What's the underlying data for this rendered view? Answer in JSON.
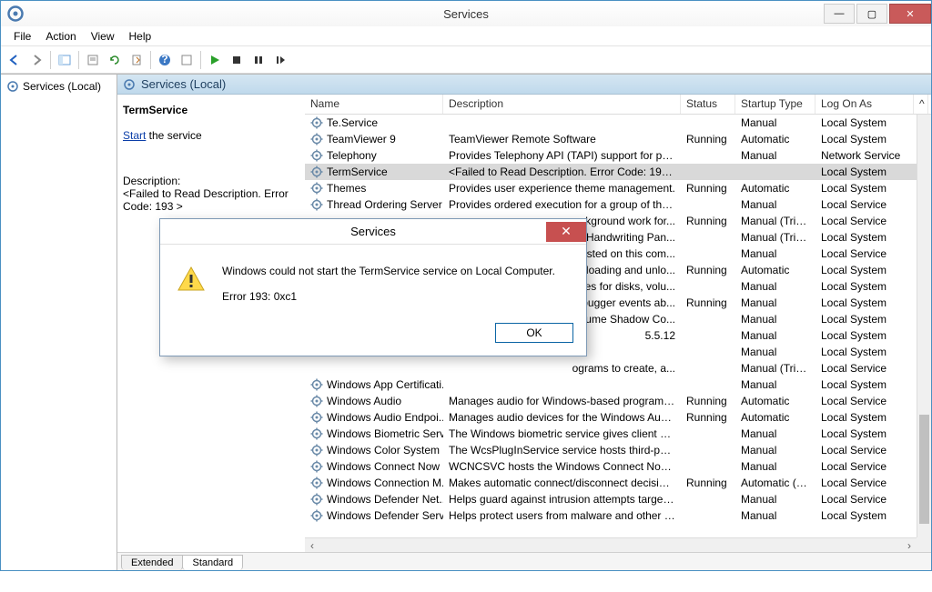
{
  "window": {
    "title": "Services"
  },
  "menubar": [
    "File",
    "Action",
    "View",
    "Help"
  ],
  "tree": {
    "root": "Services (Local)"
  },
  "panel_header": "Services (Local)",
  "detail": {
    "name": "TermService",
    "action_label": "Start",
    "action_suffix": " the service",
    "desc_label": "Description:",
    "desc_value": "<Failed to Read Description. Error Code: 193 >"
  },
  "columns": {
    "name": "Name",
    "description": "Description",
    "status": "Status",
    "startup": "Startup Type",
    "logon": "Log On As"
  },
  "services": [
    {
      "name": "Te.Service",
      "desc": "",
      "status": "",
      "startup": "Manual",
      "logon": "Local System"
    },
    {
      "name": "TeamViewer 9",
      "desc": "TeamViewer Remote Software",
      "status": "Running",
      "startup": "Automatic",
      "logon": "Local System"
    },
    {
      "name": "Telephony",
      "desc": "Provides Telephony API (TAPI) support for pro...",
      "status": "",
      "startup": "Manual",
      "logon": "Network Service"
    },
    {
      "name": "TermService",
      "desc": "<Failed to Read Description. Error Code: 193 >",
      "status": "",
      "startup": "",
      "logon": "Local System",
      "selected": true
    },
    {
      "name": "Themes",
      "desc": "Provides user experience theme management.",
      "status": "Running",
      "startup": "Automatic",
      "logon": "Local System"
    },
    {
      "name": "Thread Ordering Server",
      "desc": "Provides ordered execution for a group of thre...",
      "status": "",
      "startup": "Manual",
      "logon": "Local Service"
    },
    {
      "name": "",
      "desc": "ckground work for...",
      "status": "Running",
      "startup": "Manual (Trig...",
      "logon": "Local Service",
      "obscured": true
    },
    {
      "name": "",
      "desc": "d Handwriting Pan...",
      "status": "",
      "startup": "Manual (Trig...",
      "logon": "Local System",
      "obscured": true
    },
    {
      "name": "",
      "desc": "hosted on this com...",
      "status": "",
      "startup": "Manual",
      "logon": "Local Service",
      "obscured": true
    },
    {
      "name": "",
      "desc": "or loading and unlo...",
      "status": "Running",
      "startup": "Automatic",
      "logon": "Local System",
      "obscured": true
    },
    {
      "name": "",
      "desc": "ces for disks, volu...",
      "status": "",
      "startup": "Manual",
      "logon": "Local System",
      "obscured": true
    },
    {
      "name": "",
      "desc": "ebugger events ab...",
      "status": "Running",
      "startup": "Manual",
      "logon": "Local System",
      "obscured": true
    },
    {
      "name": "",
      "desc": "olume Shadow Co...",
      "status": "",
      "startup": "Manual",
      "logon": "Local System",
      "obscured": true
    },
    {
      "name": "",
      "desc": "5.5.12",
      "status": "",
      "startup": "Manual",
      "logon": "Local System",
      "obscured": true
    },
    {
      "name": "",
      "desc": "",
      "status": "",
      "startup": "Manual",
      "logon": "Local System",
      "obscured": true
    },
    {
      "name": "",
      "desc": "ograms to create, a...",
      "status": "",
      "startup": "Manual (Trig...",
      "logon": "Local Service",
      "obscured": true
    },
    {
      "name": "Windows App Certificati...",
      "desc": "",
      "status": "",
      "startup": "Manual",
      "logon": "Local System"
    },
    {
      "name": "Windows Audio",
      "desc": "Manages audio for Windows-based programs. ...",
      "status": "Running",
      "startup": "Automatic",
      "logon": "Local Service"
    },
    {
      "name": "Windows Audio Endpoi...",
      "desc": "Manages audio devices for the Windows Audio...",
      "status": "Running",
      "startup": "Automatic",
      "logon": "Local System"
    },
    {
      "name": "Windows Biometric Serv...",
      "desc": "The Windows biometric service gives client ap...",
      "status": "",
      "startup": "Manual",
      "logon": "Local System"
    },
    {
      "name": "Windows Color System",
      "desc": "The WcsPlugInService service hosts third-party...",
      "status": "",
      "startup": "Manual",
      "logon": "Local Service"
    },
    {
      "name": "Windows Connect Now ...",
      "desc": "WCNCSVC hosts the Windows Connect Now C...",
      "status": "",
      "startup": "Manual",
      "logon": "Local Service"
    },
    {
      "name": "Windows Connection M...",
      "desc": "Makes automatic connect/disconnect decision...",
      "status": "Running",
      "startup": "Automatic (T...",
      "logon": "Local Service"
    },
    {
      "name": "Windows Defender Net...",
      "desc": "Helps guard against intrusion attempts targeti...",
      "status": "",
      "startup": "Manual",
      "logon": "Local Service"
    },
    {
      "name": "Windows Defender Servi...",
      "desc": "Helps protect users from malware and other p...",
      "status": "",
      "startup": "Manual",
      "logon": "Local System"
    }
  ],
  "tabs": {
    "extended": "Extended",
    "standard": "Standard"
  },
  "dialog": {
    "title": "Services",
    "message": "Windows could not start the TermService service on Local Computer.",
    "error": "Error 193: 0xc1",
    "ok": "OK"
  }
}
